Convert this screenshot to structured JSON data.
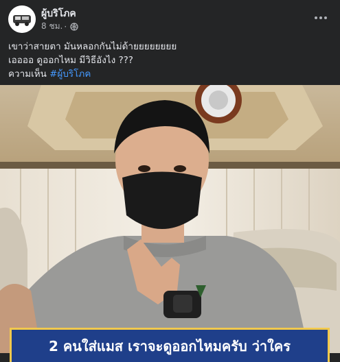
{
  "post": {
    "page_name": "ผู้บริโภค",
    "time": "8 ชม.",
    "separator": "·",
    "more_icon": "more-horizontal-icon",
    "privacy_icon": "globe-icon",
    "text_lines": [
      "เขาว่าสายตา มันหลอกกันไม่ด้ายยยยยยยย",
      "เออออ ดูออกไหม มีวิธีอังไง ???"
    ],
    "text_line3_prefix": "ความเห็น ",
    "hashtag": "#ผู้บริโภค"
  },
  "image": {
    "banner_text": "2 คนใส่แมส เราจะดูออกไหมครับ ว่าใคร"
  },
  "colors": {
    "background": "#242526",
    "text": "#e4e6eb",
    "secondary_text": "#b0b3b8",
    "hashtag": "#4599ff",
    "banner_bg": "#1f3f8a",
    "banner_border": "#f2c94c"
  }
}
